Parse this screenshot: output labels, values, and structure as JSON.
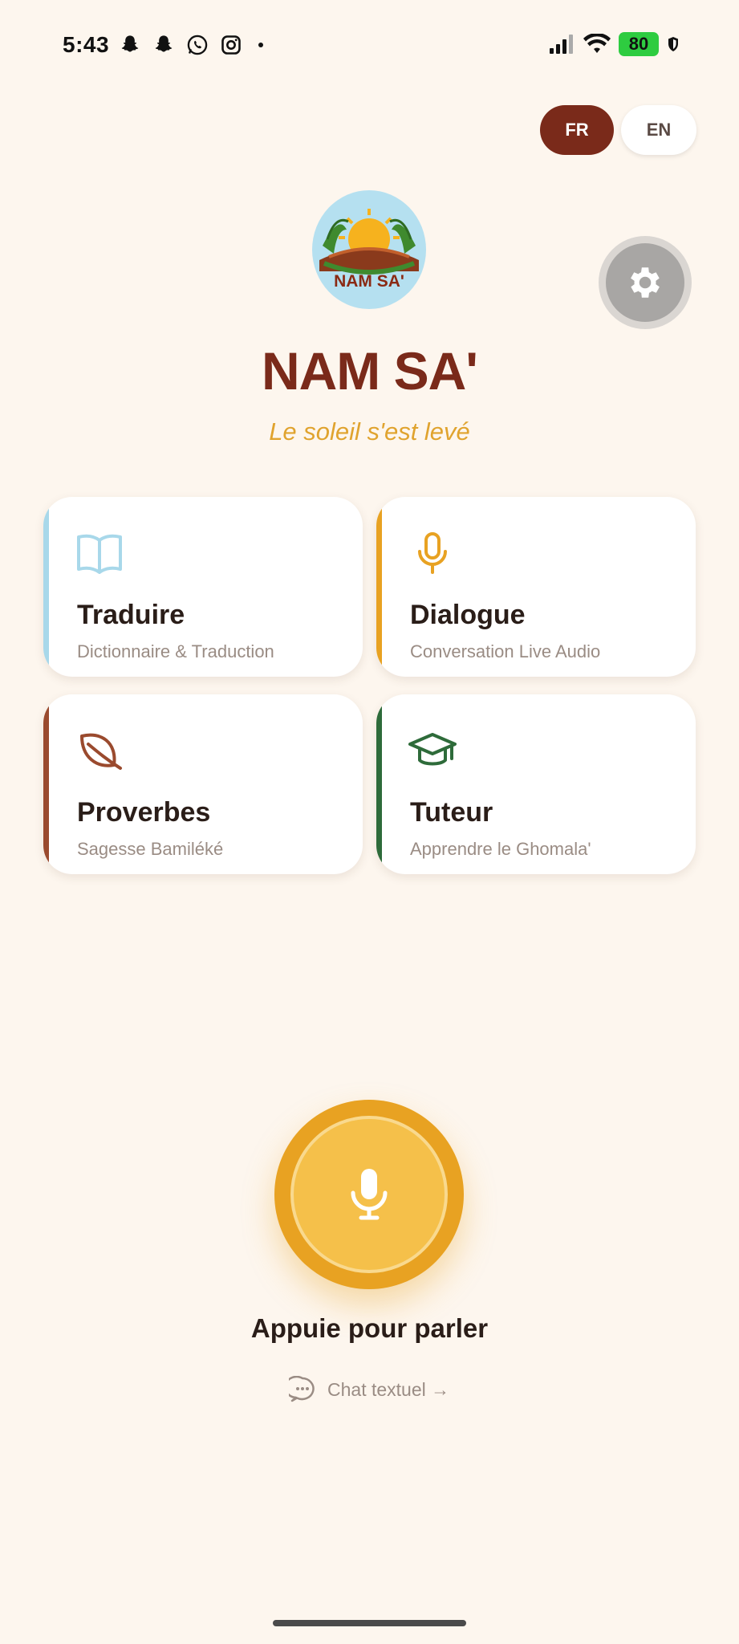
{
  "status_bar": {
    "time": "5:43",
    "battery": "80",
    "left_icons": [
      "snapchat-icon",
      "snapchat-icon",
      "whatsapp-icon",
      "instagram-icon",
      "dot-icon"
    ],
    "right_icons": [
      "signal-icon",
      "wifi-icon",
      "battery-icon",
      "shield-icon"
    ]
  },
  "language": {
    "options": [
      "FR",
      "EN"
    ],
    "selected": "FR",
    "active_color": "#7a2a1a"
  },
  "header": {
    "logo_text": "NAM SA'",
    "title": "NAM SA'",
    "subtitle": "Le soleil s'est levé"
  },
  "cards": [
    {
      "title": "Traduire",
      "subtitle": "Dictionnaire & Traduction",
      "icon": "book-icon",
      "accent": "#a8d8ea"
    },
    {
      "title": "Dialogue",
      "subtitle": "Conversation Live Audio",
      "icon": "microphone-icon",
      "accent": "#e8a222"
    },
    {
      "title": "Proverbes",
      "subtitle": "Sagesse Bamiléké",
      "icon": "leaf-icon",
      "accent": "#9a4a2e"
    },
    {
      "title": "Tuteur",
      "subtitle": "Apprendre le Ghomala'",
      "icon": "graduation-cap-icon",
      "accent": "#2e6b3a"
    }
  ],
  "voice": {
    "label": "Appuie pour parler",
    "chat_link": "Chat textuel →"
  },
  "colors": {
    "background": "#fdf6ee",
    "brand": "#7a2a1a",
    "gold": "#e8a222"
  }
}
